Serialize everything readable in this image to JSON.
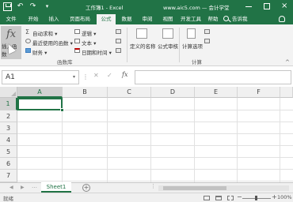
{
  "titlebar": {
    "title": "工作簿1 - Excel",
    "brand": "www.aic5.com — 会计学堂",
    "undo": "↶",
    "redo": "↷",
    "customize": "▾",
    "close": "×",
    "bg_color": "#217346"
  },
  "tabs": [
    {
      "label": "文件"
    },
    {
      "label": "开始"
    },
    {
      "label": "插入"
    },
    {
      "label": "页面布局"
    },
    {
      "label": "公式",
      "active": true
    },
    {
      "label": "数据"
    },
    {
      "label": "审阅"
    },
    {
      "label": "视图"
    },
    {
      "label": "开发工具"
    },
    {
      "label": "帮助"
    }
  ],
  "tell_me": {
    "label": "告诉我"
  },
  "ribbon": {
    "insert_function": {
      "glyph": "fx",
      "label": "插入函数"
    },
    "autosum": "自动求和 ▾",
    "recent": "最近使用的函数 ▾",
    "finance": "财务 ▾",
    "logic": "逻辑 ▾",
    "text": "文本 ▾",
    "datetime": "日期和时间 ▾",
    "defined_names": "定义的名称",
    "formula_audit": "公式审核",
    "calc_options": "计算选项",
    "group_library": "函数库",
    "group_calc": "计算",
    "collapse": "^"
  },
  "formula_bar": {
    "name_box": "A1",
    "name_box_arrow": "▾",
    "dots": "⋮",
    "cancel": "✕",
    "enter": "✓",
    "fx": "fx",
    "formula": ""
  },
  "grid": {
    "columns": [
      "A",
      "B",
      "C",
      "D",
      "E",
      "F"
    ],
    "rows": [
      "1",
      "2",
      "3",
      "4",
      "5",
      "6",
      "7"
    ],
    "selected": "A1"
  },
  "sheets": {
    "prev": "◀",
    "next": "▶",
    "dots": "…",
    "tabs": [
      "Sheet1"
    ],
    "add": "+",
    "scroll_dots": "⋮"
  },
  "status": {
    "text": "就绪",
    "zoom_minus": "−",
    "zoom_plus": "+",
    "zoom": "100%"
  }
}
